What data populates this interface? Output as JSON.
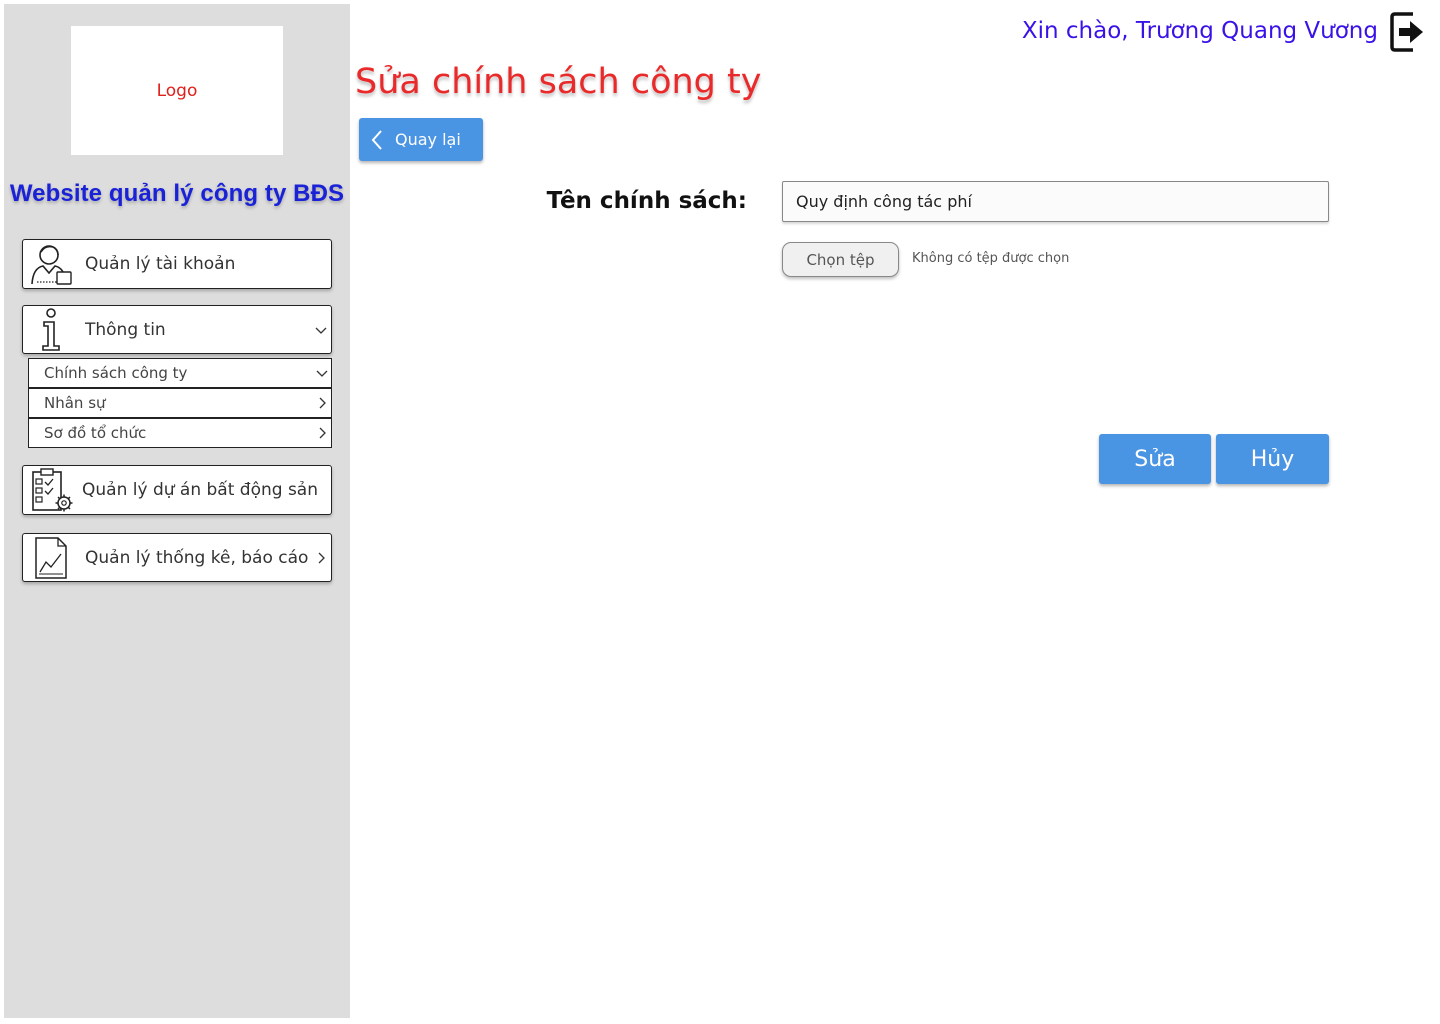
{
  "header": {
    "greeting": "Xin chào, Trương Quang Vương",
    "logout_icon": "logout-icon"
  },
  "sidebar": {
    "logo_text": "Logo",
    "site_title": "Website quản lý công ty BĐS",
    "menu": [
      {
        "label": "Quản lý tài khoản",
        "icon": "user-account-icon"
      },
      {
        "label": "Thông tin",
        "icon": "info-icon",
        "expanded": true
      },
      {
        "label": "Quản lý dự án bất động sản",
        "icon": "project-checklist-icon"
      },
      {
        "label": "Quản lý thống kê, báo cáo",
        "icon": "report-chart-icon"
      }
    ],
    "submenu": [
      {
        "label": "Chính sách công ty",
        "expanded": true
      },
      {
        "label": "Nhân sự"
      },
      {
        "label": "Sơ đồ tổ chức"
      }
    ]
  },
  "main": {
    "title": "Sửa chính sách công ty",
    "back_label": "Quay lại",
    "form": {
      "policy_name_label": "Tên chính sách:",
      "policy_name_value": "Quy định công tác phí",
      "file_button_label": "Chọn tệp",
      "file_status": "Không có tệp được chọn"
    },
    "actions": {
      "save_label": "Sửa",
      "cancel_label": "Hủy"
    }
  },
  "colors": {
    "sidebar_bg": "#dddddd",
    "accent_blue": "#4a94e4",
    "title_red": "#ea2a2a",
    "greeting_purple": "#3a12e8",
    "site_title_blue": "#1a22d8"
  }
}
